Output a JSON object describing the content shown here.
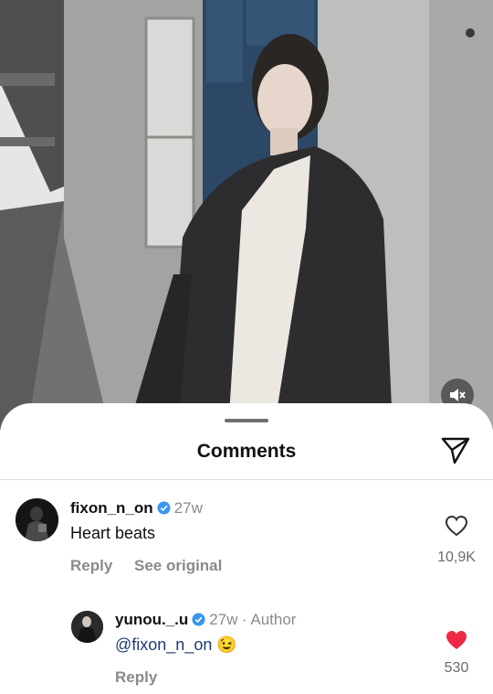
{
  "sheet": {
    "title": "Comments"
  },
  "comments": [
    {
      "username": "fixon_n_on",
      "time": "27w",
      "text": "Heart beats",
      "reply_label": "Reply",
      "see_original_label": "See original",
      "likes": "10,9K",
      "liked": false
    },
    {
      "username": "yunou._.u",
      "time": "27w",
      "author_label": "· Author",
      "mention": "@fixon_n_on",
      "emoji": "😉",
      "reply_label": "Reply",
      "likes": "530",
      "liked": true
    }
  ],
  "colors": {
    "verified": "#3897f0",
    "like_active": "#ed2945",
    "mention": "#1f3b72"
  },
  "icons": [
    "volume-mute-icon",
    "send-icon",
    "verified-badge-icon",
    "heart-outline-icon",
    "heart-filled-icon"
  ]
}
